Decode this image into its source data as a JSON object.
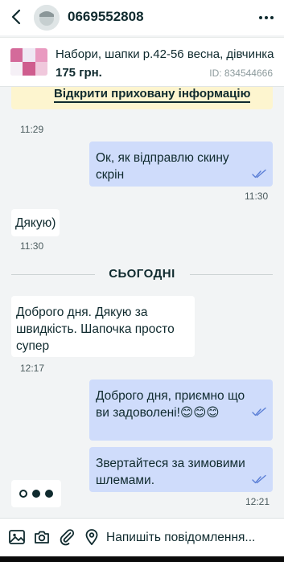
{
  "header": {
    "title": "0669552808"
  },
  "ad": {
    "title": "Набори, шапки р.42-56 весна, дівчинка",
    "price": "175 грн.",
    "id_text": "ID: 834544666"
  },
  "chat": {
    "hidden_info_link": "Відкрити приховану інформацію",
    "date_divider": "СЬОГОДНІ",
    "messages": [
      {
        "direction": "in",
        "text": "",
        "time": "11:29"
      },
      {
        "direction": "out",
        "text": "Ок, як відправлю скину скрін",
        "time": "11:30",
        "read": true
      },
      {
        "direction": "in",
        "text": "Дякую)",
        "time": "11:30"
      },
      {
        "direction": "in",
        "text": "Доброго дня. Дякую за швидкість. Шапочка просто супер",
        "time": "12:17"
      },
      {
        "direction": "out",
        "text": "Доброго дня, приємно що ви задоволені!😊😊😊",
        "time": "",
        "read": true
      },
      {
        "direction": "out",
        "text": "Звертайтеся за зимовими шлемами.",
        "time": "12:21",
        "read": true
      }
    ]
  },
  "composer": {
    "placeholder": "Напишіть повідомлення..."
  },
  "colors": {
    "outgoing_bubble": "#cfdcfb",
    "incoming_bubble": "#ffffff",
    "hidden_info_bg": "#fdf5cf",
    "text": "#0f2a2e",
    "check": "#5b7fd6",
    "background": "#f2f4f5"
  },
  "icons": {
    "back": "arrow-left-icon",
    "more": "more-horizontal-icon",
    "read_receipt": "double-check-icon",
    "gallery": "image-icon",
    "camera": "camera-icon",
    "attach": "paperclip-icon",
    "location": "location-pin-icon"
  }
}
